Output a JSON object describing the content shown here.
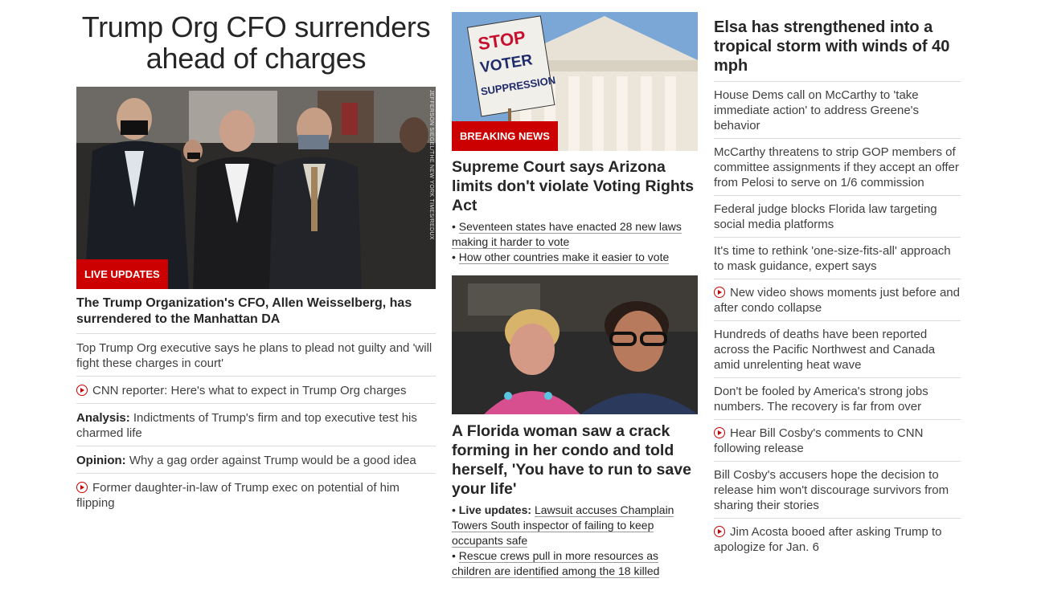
{
  "lead": {
    "title": "Trump Org CFO surrenders ahead of charges",
    "badge": "LIVE UPDATES",
    "photo_credit": "JEFFERSON SIEGEL/THE NEW YORK TIMES/REDUX",
    "headline": "The Trump Organization's CFO, Allen Weisselberg, has surrendered to the Manhattan DA",
    "items": [
      {
        "prefix": "",
        "text": "Top Trump Org executive says he plans to plead not guilty and 'will fight these charges in court'",
        "video": false
      },
      {
        "prefix": "",
        "text": "CNN reporter: Here's what to expect in Trump Org charges",
        "video": true
      },
      {
        "prefix": "Analysis:",
        "text": "Indictments of Trump's firm and top executive test his charmed life",
        "video": false
      },
      {
        "prefix": "Opinion:",
        "text": "Why a gag order against Trump would be a good idea",
        "video": false
      },
      {
        "prefix": "",
        "text": "Former daughter-in-law of Trump exec on potential of him flipping",
        "video": true
      }
    ]
  },
  "story2": {
    "badge": "BREAKING NEWS",
    "sign_text": [
      "STOP",
      "VOTER",
      "SUPPRESSION"
    ],
    "headline": "Supreme Court says Arizona limits don't violate Voting Rights Act",
    "bullets": [
      {
        "prefix": "",
        "text": "Seventeen states have enacted 28 new laws making it harder to vote"
      },
      {
        "prefix": "",
        "text": "How other countries make it easier to vote"
      }
    ]
  },
  "story3": {
    "headline": "A Florida woman saw a crack forming in her condo and told herself, 'You have to run to save your life'",
    "bullets": [
      {
        "prefix": "Live updates:",
        "text": "Lawsuit accuses Champlain Towers South inspector of failing to keep occupants safe"
      },
      {
        "prefix": "",
        "text": "Rescue crews pull in more resources as children are identified among the 18 killed"
      }
    ]
  },
  "col3": {
    "top_headline": "Elsa has strengthened into a tropical storm with winds of 40 mph",
    "items": [
      {
        "text": "House Dems call on McCarthy to 'take immediate action' to address Greene's behavior",
        "video": false
      },
      {
        "text": "McCarthy threatens to strip GOP members of committee assignments if they accept an offer from Pelosi to serve on 1/6 commission",
        "video": false
      },
      {
        "text": "Federal judge blocks Florida law targeting social media platforms",
        "video": false
      },
      {
        "text": "It's time to rethink 'one-size-fits-all' approach to mask guidance, expert says",
        "video": false
      },
      {
        "text": "New video shows moments just before and after condo collapse",
        "video": true
      },
      {
        "text": "Hundreds of deaths have been reported across the Pacific Northwest and Canada amid unrelenting heat wave",
        "video": false
      },
      {
        "text": "Don't be fooled by America's strong jobs numbers. The recovery is far from over",
        "video": false
      },
      {
        "text": "Hear Bill Cosby's comments to CNN following release",
        "video": true
      },
      {
        "text": "Bill Cosby's accusers hope the decision to release him won't discourage survivors from sharing their stories",
        "video": false
      },
      {
        "text": "Jim Acosta booed after asking Trump to apologize for Jan. 6",
        "video": true
      }
    ]
  },
  "colors": {
    "accent": "#cc0000",
    "text": "#262626",
    "divider": "#dcdcdc"
  }
}
